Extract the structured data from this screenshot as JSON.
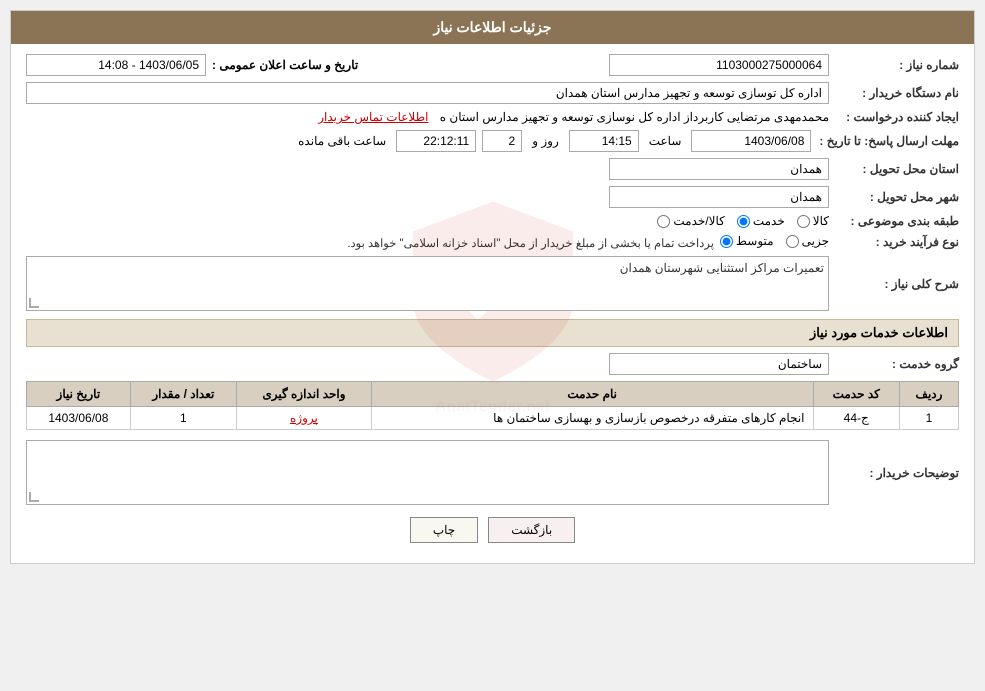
{
  "page": {
    "title": "جزئیات اطلاعات نیاز"
  },
  "header": {
    "title": "جزئیات اطلاعات نیاز"
  },
  "fields": {
    "need_number_label": "شماره نیاز :",
    "need_number_value": "1103000275000064",
    "buyer_org_label": "نام دستگاه خریدار :",
    "buyer_org_value": "اداره کل توسازی  توسعه و تجهیز مدارس استان همدان",
    "creator_label": "ایجاد کننده درخواست :",
    "creator_name": "محمدمهدی مرتضایی کاربرداز اداره کل نوسازی  توسعه و تجهیز مدارس استان ه",
    "creator_link": "اطلاعات تماس خریدار",
    "announce_date_label": "تاریخ و ساعت اعلان عمومی :",
    "announce_date_value": "1403/06/05 - 14:08",
    "deadline_label": "مهلت ارسال پاسخ: تا تاریخ :",
    "deadline_date": "1403/06/08",
    "deadline_time_label": "ساعت",
    "deadline_time": "14:15",
    "deadline_days_label": "روز و",
    "deadline_days": "2",
    "deadline_remaining_label": "ساعت باقی مانده",
    "deadline_remaining": "22:12:11",
    "province_label": "استان محل تحویل :",
    "province_value": "همدان",
    "city_label": "شهر محل تحویل :",
    "city_value": "همدان",
    "category_label": "طبقه بندی موضوعی :",
    "category_options": [
      {
        "label": "کالا",
        "value": "kala"
      },
      {
        "label": "خدمت",
        "value": "khedmat"
      },
      {
        "label": "کالا/خدمت",
        "value": "kala_khedmat"
      }
    ],
    "category_selected": "khedmat",
    "process_label": "نوع فرآیند خرید :",
    "process_options": [
      {
        "label": "جزیی",
        "value": "jozii"
      },
      {
        "label": "متوسط",
        "value": "motevaset"
      }
    ],
    "process_selected": "motevaset",
    "process_desc": "پرداخت تمام یا بخشی از مبلغ خریدار از محل \"اسناد خزانه اسلامی\" خواهد بود.",
    "need_desc_label": "شرح کلی نیاز :",
    "need_desc_value": "تعمیرات مراکز استثنایی شهرستان همدان",
    "services_section": "اطلاعات خدمات مورد نیاز",
    "service_group_label": "گروه خدمت :",
    "service_group_value": "ساختمان",
    "table": {
      "headers": [
        "ردیف",
        "کد حدمت",
        "نام حدمت",
        "واحد اندازه گیری",
        "تعداد / مقدار",
        "تاریخ نیاز"
      ],
      "rows": [
        {
          "row": "1",
          "code": "ج-44",
          "name": "انجام کارهای متفرقه درخصوص بازسازی و بهسازی ساختمان ها",
          "unit": "پروژه",
          "qty": "1",
          "date": "1403/06/08"
        }
      ]
    },
    "buyer_notes_label": "توضیحات خریدار :",
    "buyer_notes_value": ""
  },
  "buttons": {
    "print": "چاپ",
    "back": "بازگشت"
  }
}
